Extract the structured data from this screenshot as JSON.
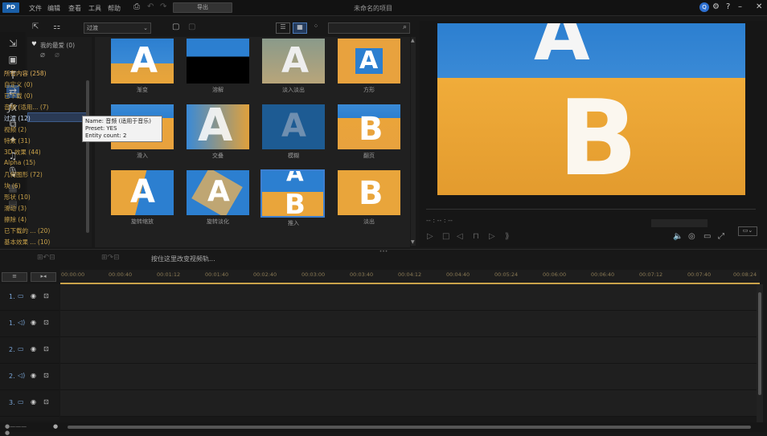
{
  "menu": [
    "文件",
    "编辑",
    "查看",
    "工具",
    "帮助"
  ],
  "titlebar": {
    "logo": "PD",
    "export_label": "导出",
    "project_title": "未命名的项目"
  },
  "media": {
    "select_value": "过渡",
    "favorites_label": "我的最爱 (0)",
    "categories": [
      {
        "label": "所有内容 (258)"
      },
      {
        "label": "自定义 (0)"
      },
      {
        "label": "已下载 (0)"
      },
      {
        "label": "音频 (适用... (7)"
      },
      {
        "label": "过渡 (12)"
      },
      {
        "label": "视频 (2)"
      },
      {
        "label": "特效 (31)"
      },
      {
        "label": "3D 效果 (44)"
      },
      {
        "label": "Alpha (15)"
      },
      {
        "label": "几何图形 (72)"
      },
      {
        "label": "块 (6)"
      },
      {
        "label": "形状 (10)"
      },
      {
        "label": "滑动 (3)"
      },
      {
        "label": "擦除 (4)"
      },
      {
        "label": "已下载的 ... (20)"
      },
      {
        "label": "基本效果 ... (10)"
      }
    ],
    "tooltip": {
      "line1": "Name: 音频 (适用于音乐)",
      "line2": "Preset: YES",
      "line3": "Entity count: 2"
    },
    "thumbs": [
      {
        "label": "渐变"
      },
      {
        "label": "溶解"
      },
      {
        "label": "淡入淡出"
      },
      {
        "label": "方形"
      },
      {
        "label": "滑入"
      },
      {
        "label": "交叠"
      },
      {
        "label": "模糊"
      },
      {
        "label": "翻页"
      },
      {
        "label": "旋转缩放"
      },
      {
        "label": "旋转淡化"
      },
      {
        "label": "推入"
      },
      {
        "label": "淡出"
      }
    ]
  },
  "preview": {
    "timecode": "-- : -- : --"
  },
  "timeline": {
    "hint": "按住这里改变视频轨...",
    "ticks": [
      "00:00:00",
      "00:00:40",
      "00:01:12",
      "00:01:40",
      "00:02:40",
      "00:03:00",
      "00:03:40",
      "00:04:12",
      "00:04:40",
      "00:05:24",
      "00:06:00",
      "00:06:40",
      "00:07:12",
      "00:07:40",
      "00:08:24"
    ],
    "tracks": [
      {
        "label": "1."
      },
      {
        "label": "1."
      },
      {
        "label": "2."
      },
      {
        "label": "2."
      },
      {
        "label": "3."
      }
    ]
  }
}
